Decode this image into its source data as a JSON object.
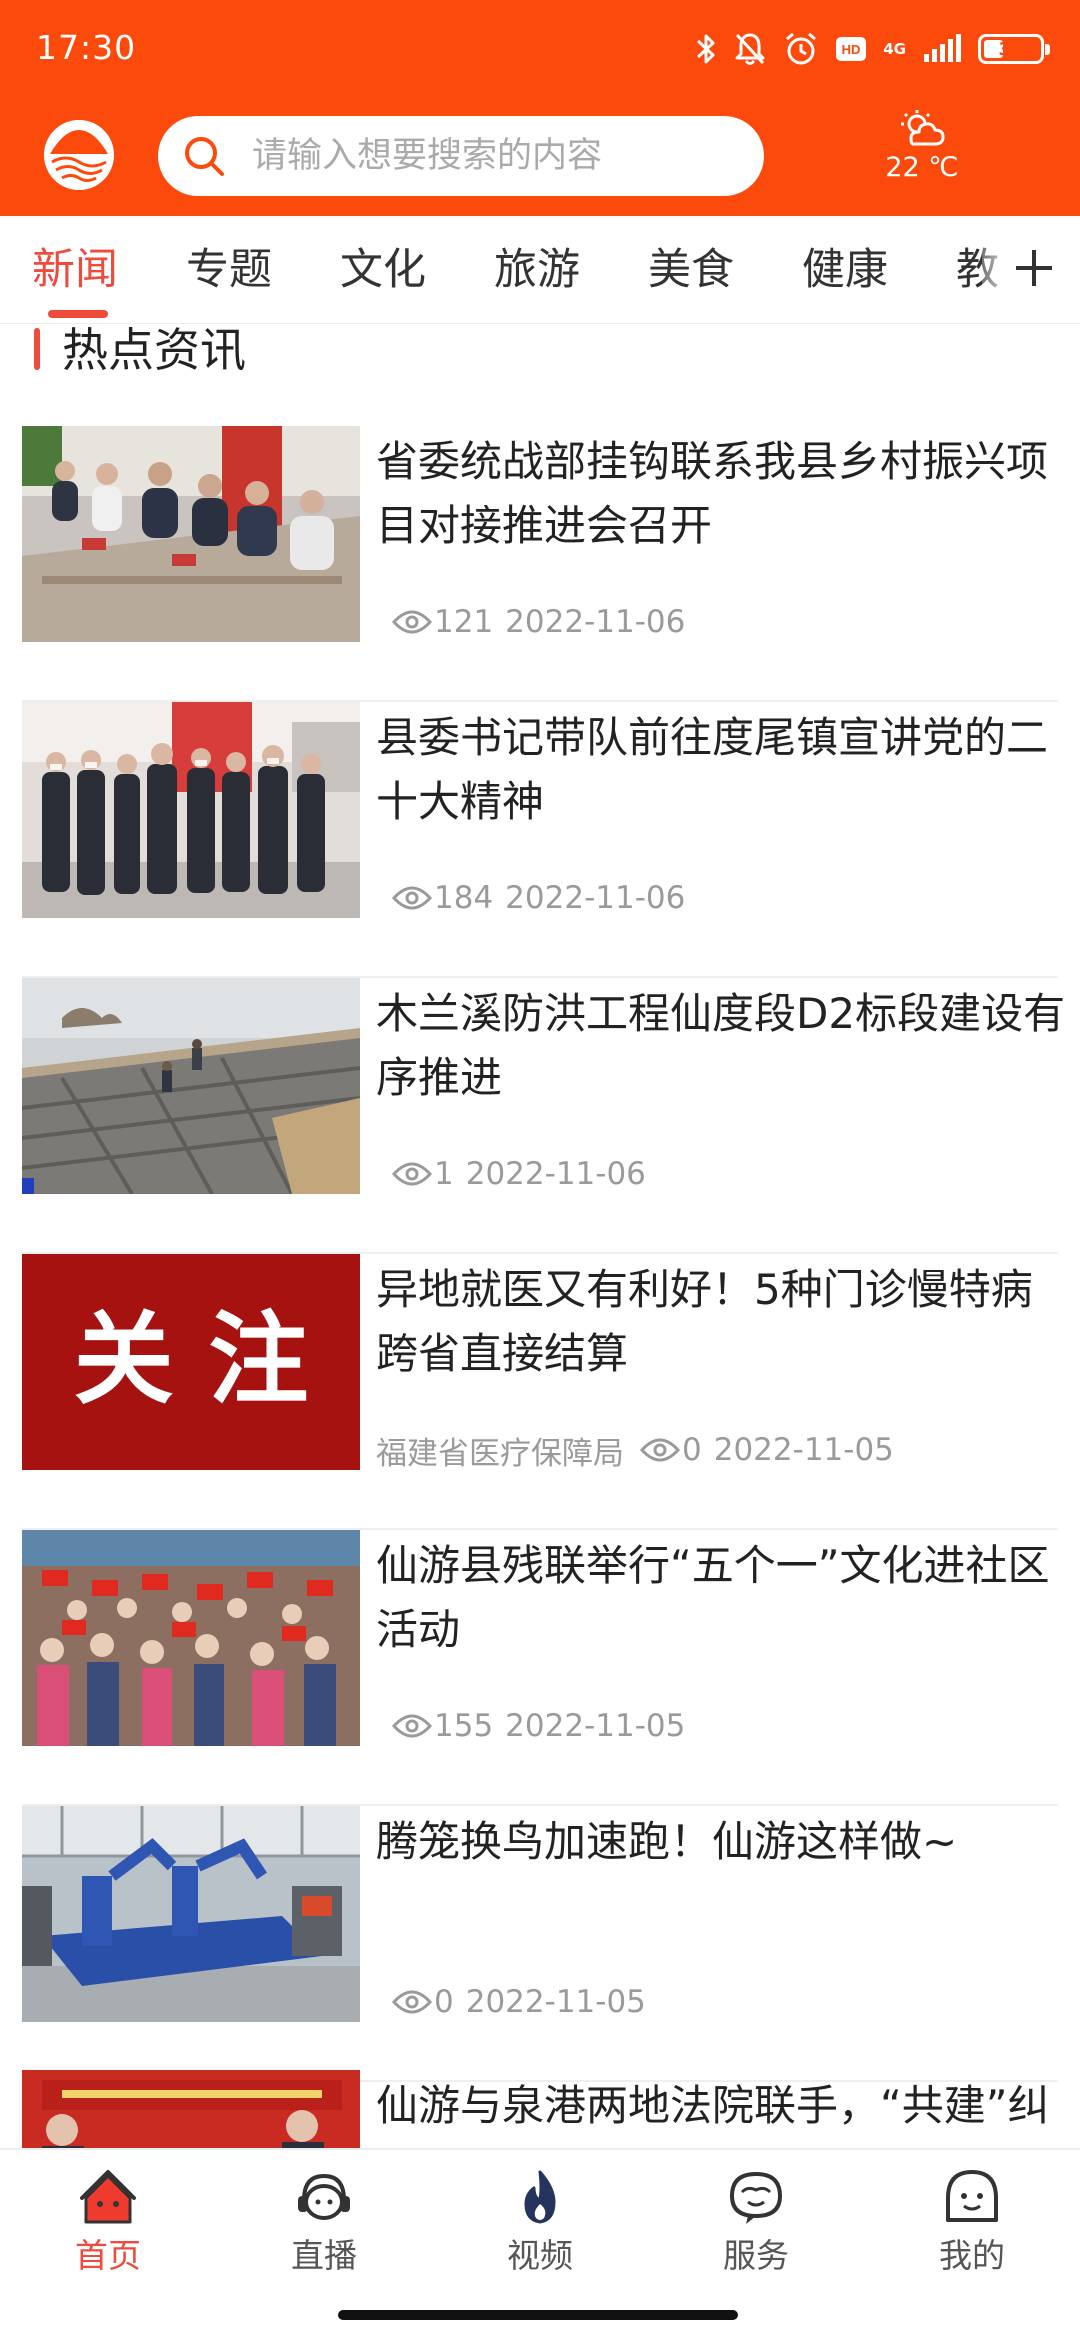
{
  "status": {
    "time": "17:30",
    "network": "4G",
    "battery": "36",
    "battery_level": 0.36,
    "icons": [
      "bluetooth-icon",
      "mute-icon",
      "alarm-icon",
      "hd-icon",
      "signal-icon",
      "battery-icon"
    ]
  },
  "header": {
    "search_placeholder": "请输入想要搜索的内容",
    "weather": {
      "icon": "partly-cloudy-icon",
      "temp": "22 ℃"
    },
    "accent": "#fb4a0c"
  },
  "tabs": [
    {
      "label": "新闻",
      "active": true
    },
    {
      "label": "专题"
    },
    {
      "label": "文化"
    },
    {
      "label": "旅游"
    },
    {
      "label": "美食"
    },
    {
      "label": "健康"
    },
    {
      "label": "教"
    }
  ],
  "section": {
    "title": "热点资讯"
  },
  "news": [
    {
      "title": "省委统战部挂钩联系我县乡村振兴项目对接推进会召开",
      "source": "",
      "views": "121",
      "date": "2022-11-06",
      "image": "meeting-photo"
    },
    {
      "title": "县委书记带队前往度尾镇宣讲党的二十大精神",
      "source": "",
      "views": "184",
      "date": "2022-11-06",
      "image": "group-visit-photo"
    },
    {
      "title": "木兰溪防洪工程仙度段D2标段建设有序推进",
      "source": "",
      "views": "1",
      "date": "2022-11-06",
      "image": "construction-site-photo"
    },
    {
      "title": "异地就医又有利好！5种门诊慢特病跨省直接结算",
      "source": "福建省医疗保障局",
      "views": "0",
      "date": "2022-11-05",
      "image": "attention-banner",
      "image_text": "关 注"
    },
    {
      "title": "仙游县残联举行“五个一”文化进社区活动",
      "source": "",
      "views": "155",
      "date": "2022-11-05",
      "image": "crowd-flags-photo"
    },
    {
      "title": "腾笼换鸟加速跑！仙游这样做~",
      "source": "",
      "views": "0",
      "date": "2022-11-05",
      "image": "factory-robot-photo"
    },
    {
      "title": "仙游与泉港两地法院联手，“共建”纠纷化解“直通车”",
      "source": "",
      "views": "",
      "date": "",
      "image": "court-event-photo"
    }
  ],
  "bottom_nav": [
    {
      "label": "首页",
      "icon": "home-icon",
      "active": true
    },
    {
      "label": "直播",
      "icon": "live-headset-icon"
    },
    {
      "label": "视频",
      "icon": "flame-icon"
    },
    {
      "label": "服务",
      "icon": "service-icon"
    },
    {
      "label": "我的",
      "icon": "profile-icon"
    }
  ]
}
